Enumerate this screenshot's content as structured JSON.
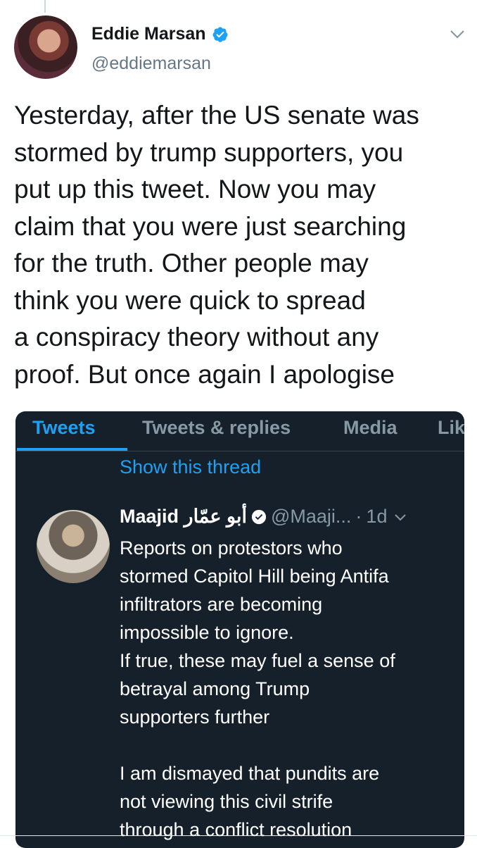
{
  "tweet": {
    "display_name": "Eddie Marsan",
    "handle": "@eddiemarsan",
    "text": "Yesterday, after the US senate was\nstormed by trump supporters, you\nput up this tweet. Now you may\nclaim that you were just searching\nfor the truth. Other people may\nthink you were quick to spread\na conspiracy theory without any\nproof.  But once again I apologise"
  },
  "embedded_screenshot": {
    "tabs": [
      {
        "label": "Tweets",
        "active": true
      },
      {
        "label": "Tweets & replies",
        "active": false
      },
      {
        "label": "Media",
        "active": false
      },
      {
        "label": "Lik",
        "active": false
      }
    ],
    "show_thread": "Show this thread",
    "quoted_tweet": {
      "display_name": "Maajid أبو عمّار",
      "handle": "@Maaji...",
      "separator": "·",
      "time": "1d",
      "text": "Reports on protestors who\nstormed Capitol Hill being Antifa\ninfiltrators are becoming\nimpossible to ignore.\nIf true, these may fuel a sense of\nbetrayal among Trump\nsupporters further\n\nI am dismayed that pundits are\nnot viewing this civil strife\nthrough a conflict resolution"
    }
  },
  "colors": {
    "accent": "#1da1f2",
    "dark_bg": "#15202b",
    "secondary_text": "#657786"
  },
  "icons": [
    "verified-badge-icon",
    "chevron-down-icon"
  ]
}
